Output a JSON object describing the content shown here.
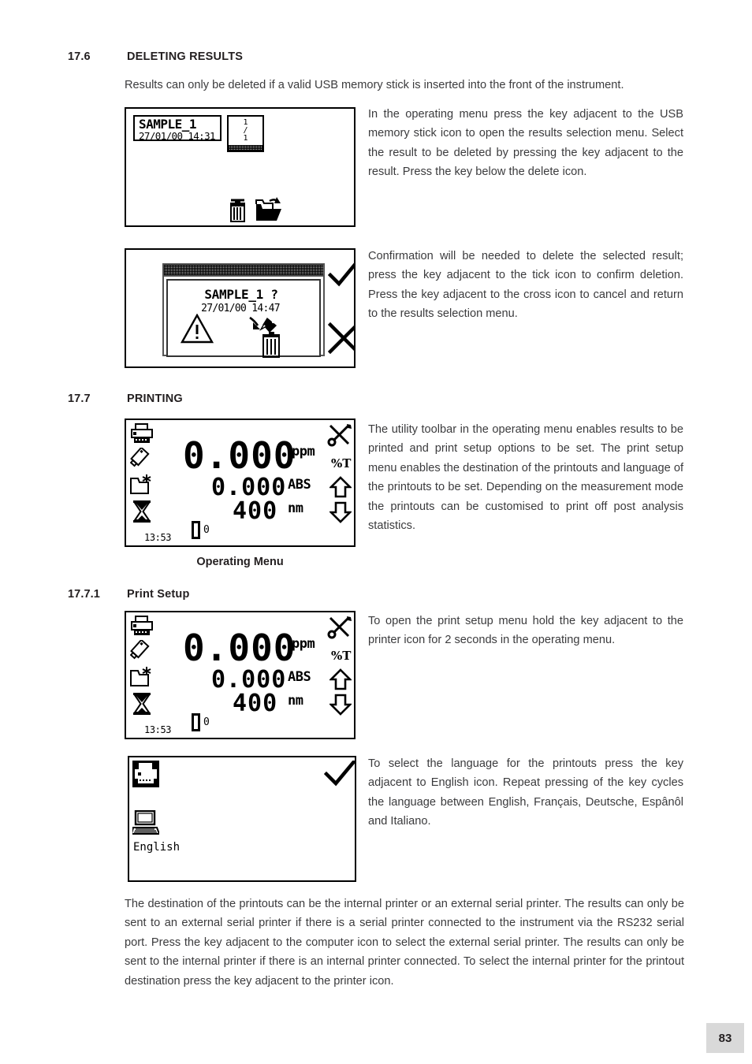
{
  "page": {
    "number": "83"
  },
  "sections": [
    {
      "number": "17.6",
      "title": "DELETING RESULTS",
      "intro": "Results can only be deleted if a valid USB memory stick is inserted into the front of the instrument.",
      "paragraphs": [
        "In the operating menu press the key adjacent to the USB memory stick icon to open the results selection menu. Select the result to be deleted by pressing the key adjacent to the result. Press the key below the delete icon.",
        "Confirmation will be needed to delete the selected result; press the key adjacent to the tick icon to confirm deletion. Press the key adjacent to the cross icon to cancel and return to the results selection menu."
      ]
    },
    {
      "number": "17.7",
      "title": "PRINTING",
      "paragraphs": [
        "The utility toolbar in the operating menu enables results to be printed and print setup options to be set. The print setup menu enables the destination of the printouts and language of the printouts to be set. Depending on the measurement mode the printouts can be customised to print off post analysis statistics."
      ],
      "caption": "Operating Menu"
    },
    {
      "number": "17.7.1",
      "title": "Print Setup",
      "paragraphs": [
        "To open the print setup menu hold the key adjacent to the printer icon for 2 seconds in the operating menu.",
        "To select the language for the printouts press the key adjacent to English icon. Repeat pressing of the key cycles the language between English, Français, Deutsche, Espânôl and Italiano."
      ]
    }
  ],
  "closing_paragraph": "The destination of the printouts can be the internal printer or an external serial printer. The results can only be sent to an external serial printer if there is a serial printer connected to the instrument via the RS232 serial port. Press the key adjacent to the computer icon to select the external serial printer. The results can only be sent to the internal printer if there is an internal printer connected. To select the internal printer for the printout destination press the key adjacent to the printer icon.",
  "screens": {
    "results_selection": {
      "result_name": "SAMPLE_1",
      "result_date": "27/01/00 14:31",
      "page_current": "1",
      "page_separator": "/",
      "page_total": "1",
      "icons": [
        "trash-icon",
        "open-folder-icon"
      ]
    },
    "delete_confirm": {
      "prompt": "SAMPLE_1 ?",
      "date": "27/01/00 14:47",
      "icons": [
        "warning-triangle-icon",
        "delete-result-icon",
        "tick-icon",
        "cross-icon"
      ]
    },
    "operating_menu": {
      "value_main": "0.000",
      "unit_main": "ppm",
      "value_abs": "0.000",
      "unit_abs": "ABS",
      "value_wavelength": "400",
      "unit_wavelength": "nm",
      "time": "13:53",
      "cell_position": "0",
      "left_icons": [
        "printer-icon",
        "usb-stick-icon",
        "new-folder-icon",
        "hourglass-icon"
      ],
      "right_icons": [
        "tools-icon",
        "percent-t-label",
        "up-arrow-icon",
        "down-arrow-icon"
      ],
      "percent_t": "%T"
    },
    "print_setup": {
      "language": "English",
      "icons": [
        "printer-icon-selected",
        "computer-icon",
        "tick-icon"
      ]
    }
  }
}
